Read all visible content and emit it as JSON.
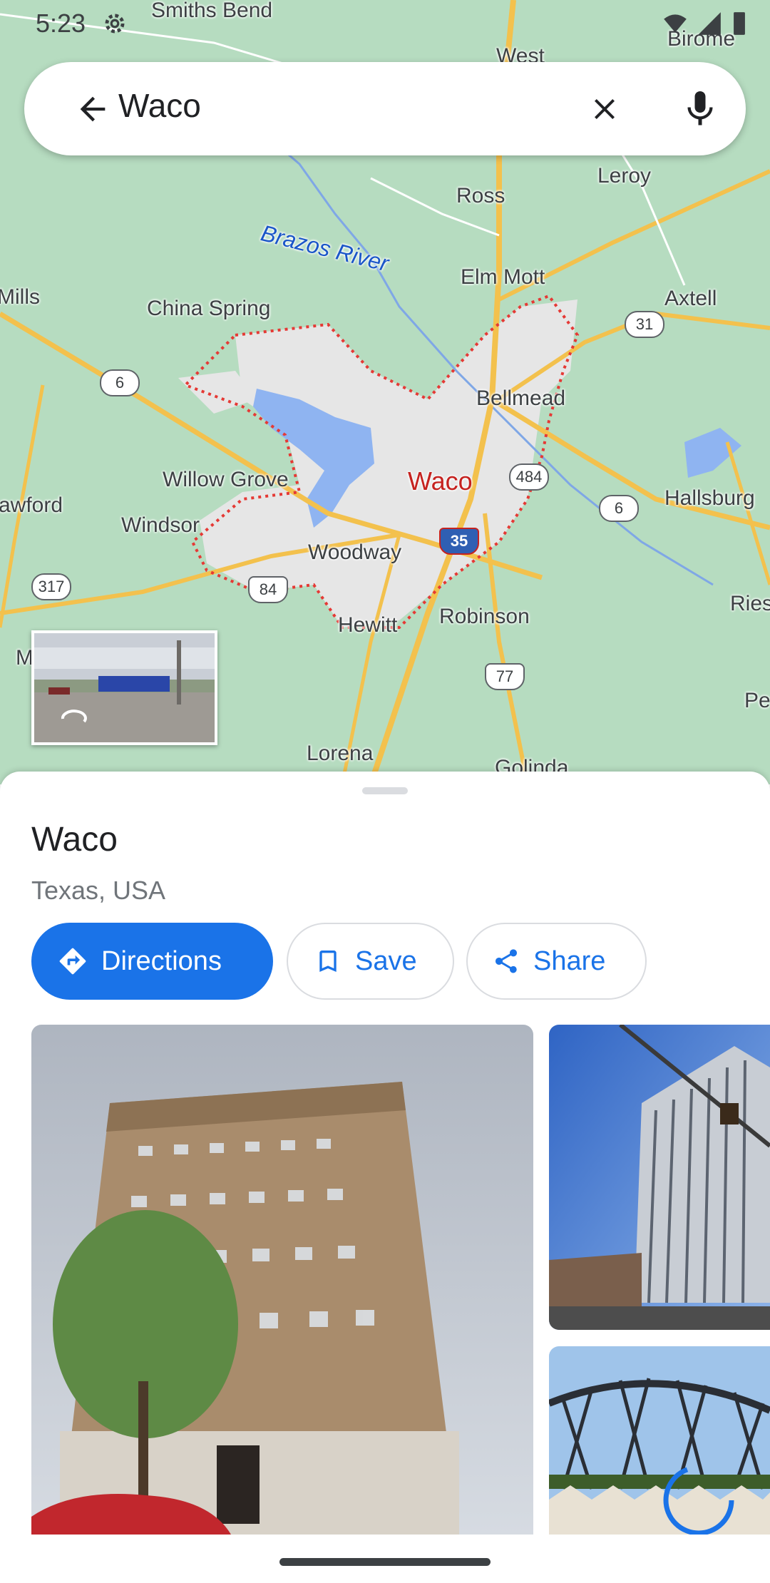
{
  "status_bar": {
    "time": "5:23"
  },
  "search": {
    "query": "Waco"
  },
  "map": {
    "labels": {
      "smiths_bend": "Smiths Bend",
      "west": "West",
      "birome": "Birome",
      "ross": "Ross",
      "leroy": "Leroy",
      "brazos_river": "Brazos River",
      "elm_mott": "Elm Mott",
      "mills": "Mills",
      "china_spring": "China Spring",
      "axtell": "Axtell",
      "bellmead": "Bellmead",
      "willow_grove": "Willow Grove",
      "waco": "Waco",
      "hallsburg": "Hallsburg",
      "crawford": "awford",
      "windsor": "Windsor",
      "woodway": "Woodway",
      "hewitt": "Hewitt",
      "robinson": "Robinson",
      "ries": "Ries",
      "pe": "Pe",
      "m": "M",
      "lorena": "Lorena",
      "golinda": "Golinda"
    },
    "shields": {
      "r6_west": "6",
      "r31": "31",
      "r484": "484",
      "r6_east": "6",
      "i35": "35",
      "r317": "317",
      "us84": "84",
      "us77": "77"
    }
  },
  "place": {
    "title": "Waco",
    "subtitle": "Texas, USA",
    "actions": {
      "directions": "Directions",
      "save": "Save",
      "share": "Share"
    }
  },
  "colors": {
    "accent": "#1a73e8",
    "map_green": "#a8d5b5",
    "boundary": "#e53935",
    "highway": "#f6c347"
  }
}
